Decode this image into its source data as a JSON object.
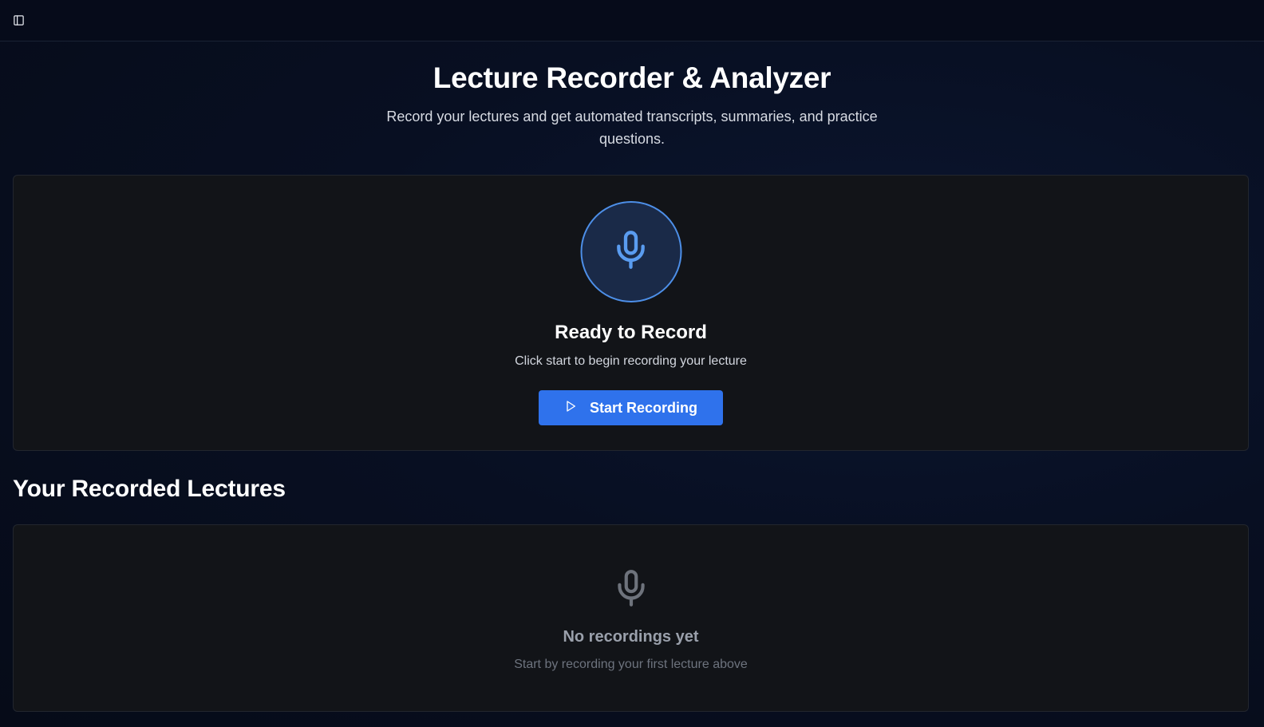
{
  "header": {
    "title": "Lecture Recorder & Analyzer",
    "subtitle": "Record your lectures and get automated transcripts, summaries, and practice questions."
  },
  "recorder": {
    "status_title": "Ready to Record",
    "status_desc": "Click start to begin recording your lecture",
    "start_label": "Start Recording",
    "icon": "microphone-icon"
  },
  "lectures": {
    "section_title": "Your Recorded Lectures",
    "empty_title": "No recordings yet",
    "empty_desc": "Start by recording your first lecture above",
    "icon": "microphone-icon"
  },
  "colors": {
    "accent": "#2f72ec",
    "mic_ring": "#4d8fe8",
    "card_bg": "#121418"
  }
}
